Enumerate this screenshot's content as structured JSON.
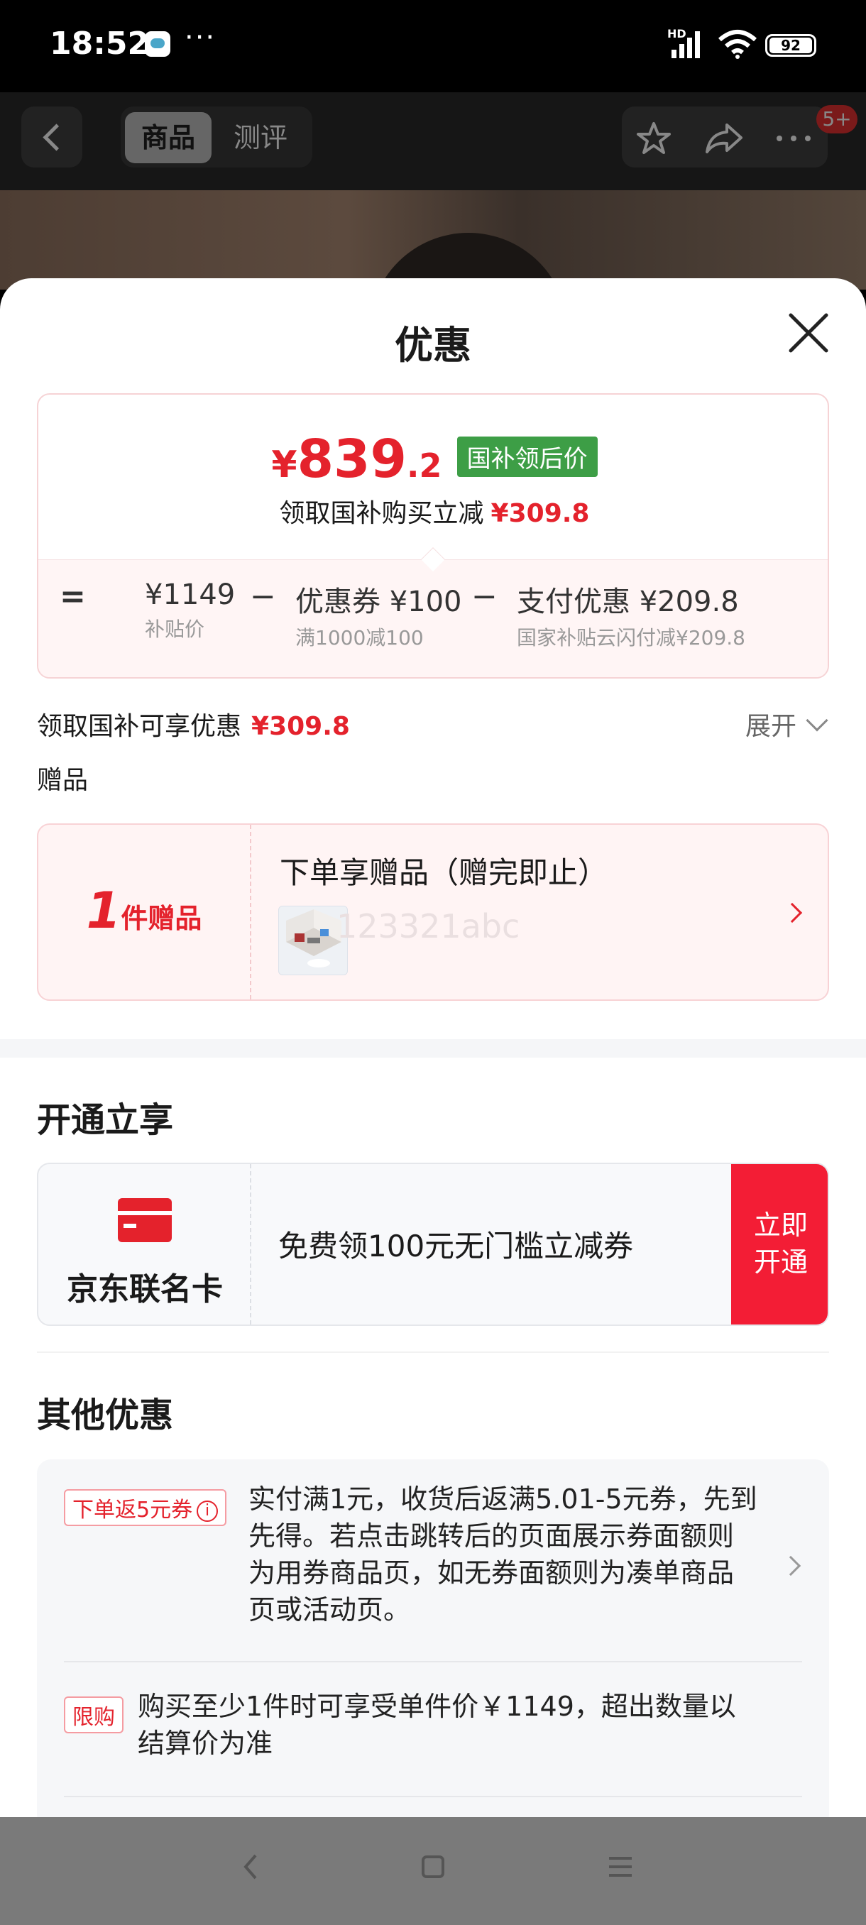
{
  "status_bar": {
    "time": "18:52",
    "dots": "···",
    "network": "HD",
    "battery": "92"
  },
  "nav": {
    "tab_product": "商品",
    "tab_review": "测评",
    "badge": "5+"
  },
  "sheet": {
    "title": "优惠",
    "price": {
      "yen": "¥",
      "integer": "839",
      "decimal": ".2",
      "tag": "国补领后价",
      "sub_text": "领取国补购买立减",
      "sub_amount": "¥309.8"
    },
    "calc": {
      "equals": "=",
      "items": [
        {
          "amount": "¥1149",
          "note": "补贴价"
        },
        {
          "op": "−",
          "amount": "优惠券 ¥100",
          "note": "满1000减100"
        },
        {
          "op": "−",
          "amount": "支付优惠 ¥209.8",
          "note": "国家补贴云闪付减¥209.8"
        }
      ]
    },
    "gov_line": {
      "text": "领取国补可享优惠",
      "amount": "¥309.8",
      "expand": "展开"
    },
    "gift": {
      "section_label": "赠品",
      "count": "1",
      "count_label": "件赠品",
      "title": "下单享赠品（赠完即止）",
      "watermark": "123321abc"
    },
    "open": {
      "section_title": "开通立享",
      "card_name": "京东联名卡",
      "desc": "免费领100元无门槛立减券",
      "button_line1": "立即",
      "button_line2": "开通"
    },
    "other": {
      "section_title": "其他优惠",
      "offers": [
        {
          "tag": "下单返5元券",
          "lines": [
            "实付满1元，收货后返满5.01-5元券，先到",
            "先得。若点击跳转后的页面展示券面额则",
            "为用券商品页，如无券面额则为凑单商品",
            "页或活动页。"
          ]
        },
        {
          "tag": "限购",
          "lines": [
            "购买至少1件时可享受单件价￥1149，超出数量以",
            "结算价为准"
          ]
        }
      ]
    }
  },
  "colors": {
    "accent_red": "#e4222c",
    "gov_green": "#3d9e46",
    "open_button": "#f31d35"
  }
}
